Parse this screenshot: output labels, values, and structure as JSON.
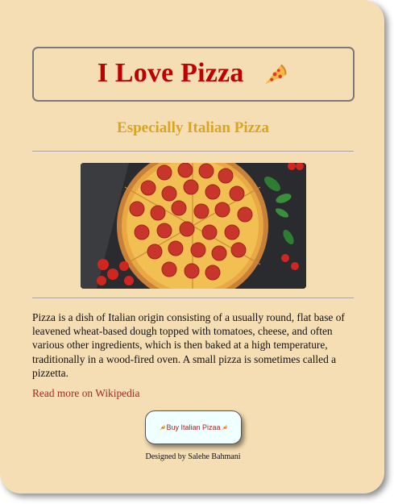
{
  "header": {
    "title": "I Love Pizza",
    "title_icon": "pizza-slice-icon"
  },
  "subtitle": "Especially Italian Pizza",
  "image": {
    "subject": "pizza-photo"
  },
  "description": "Pizza is a dish of Italian origin consisting of a usually round, flat base of leavened wheat-based dough topped with tomatoes, cheese, and often various other ingredients, which is then baked at a high temperature, traditionally in a wood-fired oven. A small pizza is sometimes called a pizzetta.",
  "link": {
    "label": "Read more on Wikipedia"
  },
  "buy_button": {
    "label": "Buy Italian Pizaa",
    "icon": "pizza-slice-icon"
  },
  "footer": {
    "credit": "Designed by Salehe Bahmani"
  },
  "colors": {
    "background": "#f5deb3",
    "title": "#c00000",
    "subtitle": "#daa520",
    "link": "#a52a2a",
    "button_bg": "#f0ffff"
  }
}
